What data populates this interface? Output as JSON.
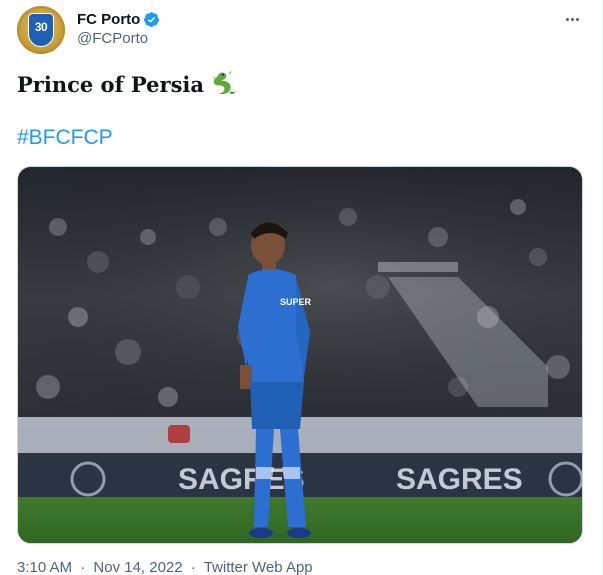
{
  "author": {
    "display_name": "FC Porto",
    "handle": "@FCPorto",
    "avatar_text": "30",
    "verified_icon": "verified-badge-icon",
    "verified_color": "#1d9bf0"
  },
  "more_menu": {
    "icon": "more-options-icon"
  },
  "tweet": {
    "text": "Prince of Persia",
    "emoji_icon": "dragon-emoji-icon",
    "hashtag": "#BFCFCP"
  },
  "media": {
    "type": "photo",
    "scene_text": {
      "jersey": "SUPER",
      "board_left": "SAGRES",
      "board_right": "SAGRES"
    }
  },
  "footer": {
    "time": "3:10 AM",
    "date": "Nov 14, 2022",
    "source": "Twitter Web App",
    "separator": "·"
  },
  "colors": {
    "link_blue": "#1d9bf0",
    "secondary_text": "#536471",
    "primary_text": "#0f1419",
    "porto_blue": "#1f5fb4"
  }
}
